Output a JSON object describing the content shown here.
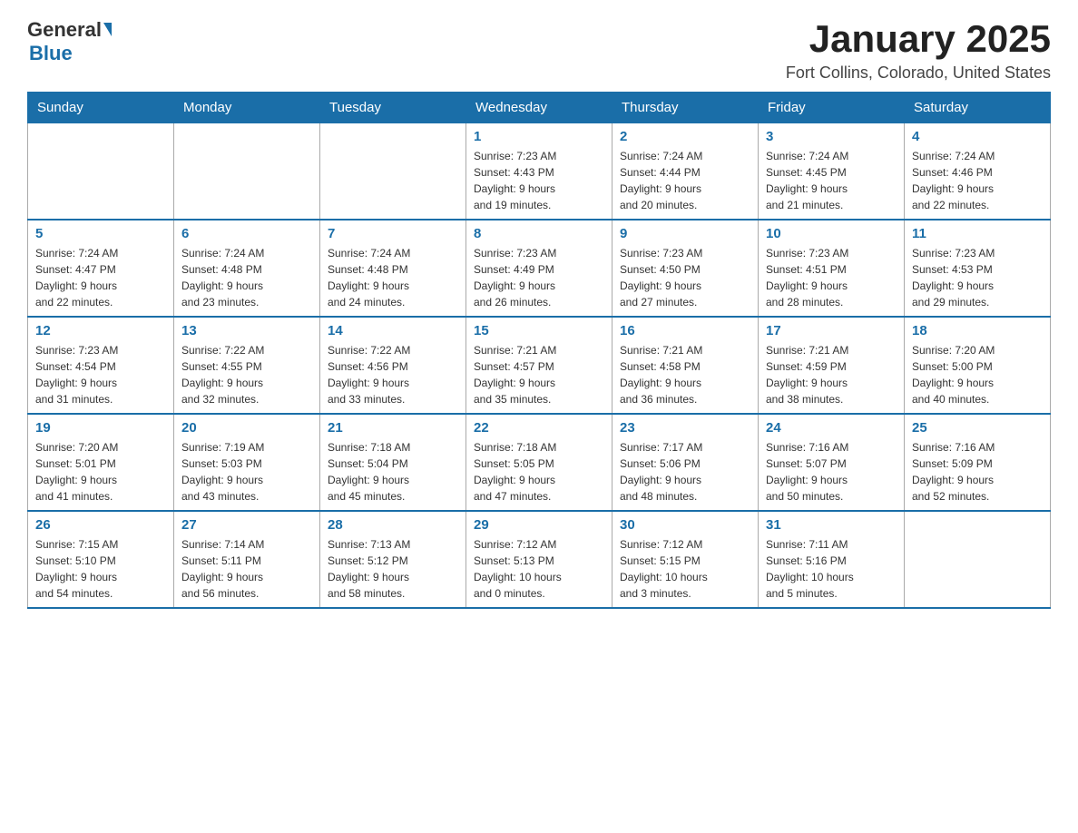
{
  "header": {
    "logo_general": "General",
    "logo_blue": "Blue",
    "month_title": "January 2025",
    "location": "Fort Collins, Colorado, United States"
  },
  "weekdays": [
    "Sunday",
    "Monday",
    "Tuesday",
    "Wednesday",
    "Thursday",
    "Friday",
    "Saturday"
  ],
  "weeks": [
    [
      {
        "day": "",
        "info": ""
      },
      {
        "day": "",
        "info": ""
      },
      {
        "day": "",
        "info": ""
      },
      {
        "day": "1",
        "info": "Sunrise: 7:23 AM\nSunset: 4:43 PM\nDaylight: 9 hours\nand 19 minutes."
      },
      {
        "day": "2",
        "info": "Sunrise: 7:24 AM\nSunset: 4:44 PM\nDaylight: 9 hours\nand 20 minutes."
      },
      {
        "day": "3",
        "info": "Sunrise: 7:24 AM\nSunset: 4:45 PM\nDaylight: 9 hours\nand 21 minutes."
      },
      {
        "day": "4",
        "info": "Sunrise: 7:24 AM\nSunset: 4:46 PM\nDaylight: 9 hours\nand 22 minutes."
      }
    ],
    [
      {
        "day": "5",
        "info": "Sunrise: 7:24 AM\nSunset: 4:47 PM\nDaylight: 9 hours\nand 22 minutes."
      },
      {
        "day": "6",
        "info": "Sunrise: 7:24 AM\nSunset: 4:48 PM\nDaylight: 9 hours\nand 23 minutes."
      },
      {
        "day": "7",
        "info": "Sunrise: 7:24 AM\nSunset: 4:48 PM\nDaylight: 9 hours\nand 24 minutes."
      },
      {
        "day": "8",
        "info": "Sunrise: 7:23 AM\nSunset: 4:49 PM\nDaylight: 9 hours\nand 26 minutes."
      },
      {
        "day": "9",
        "info": "Sunrise: 7:23 AM\nSunset: 4:50 PM\nDaylight: 9 hours\nand 27 minutes."
      },
      {
        "day": "10",
        "info": "Sunrise: 7:23 AM\nSunset: 4:51 PM\nDaylight: 9 hours\nand 28 minutes."
      },
      {
        "day": "11",
        "info": "Sunrise: 7:23 AM\nSunset: 4:53 PM\nDaylight: 9 hours\nand 29 minutes."
      }
    ],
    [
      {
        "day": "12",
        "info": "Sunrise: 7:23 AM\nSunset: 4:54 PM\nDaylight: 9 hours\nand 31 minutes."
      },
      {
        "day": "13",
        "info": "Sunrise: 7:22 AM\nSunset: 4:55 PM\nDaylight: 9 hours\nand 32 minutes."
      },
      {
        "day": "14",
        "info": "Sunrise: 7:22 AM\nSunset: 4:56 PM\nDaylight: 9 hours\nand 33 minutes."
      },
      {
        "day": "15",
        "info": "Sunrise: 7:21 AM\nSunset: 4:57 PM\nDaylight: 9 hours\nand 35 minutes."
      },
      {
        "day": "16",
        "info": "Sunrise: 7:21 AM\nSunset: 4:58 PM\nDaylight: 9 hours\nand 36 minutes."
      },
      {
        "day": "17",
        "info": "Sunrise: 7:21 AM\nSunset: 4:59 PM\nDaylight: 9 hours\nand 38 minutes."
      },
      {
        "day": "18",
        "info": "Sunrise: 7:20 AM\nSunset: 5:00 PM\nDaylight: 9 hours\nand 40 minutes."
      }
    ],
    [
      {
        "day": "19",
        "info": "Sunrise: 7:20 AM\nSunset: 5:01 PM\nDaylight: 9 hours\nand 41 minutes."
      },
      {
        "day": "20",
        "info": "Sunrise: 7:19 AM\nSunset: 5:03 PM\nDaylight: 9 hours\nand 43 minutes."
      },
      {
        "day": "21",
        "info": "Sunrise: 7:18 AM\nSunset: 5:04 PM\nDaylight: 9 hours\nand 45 minutes."
      },
      {
        "day": "22",
        "info": "Sunrise: 7:18 AM\nSunset: 5:05 PM\nDaylight: 9 hours\nand 47 minutes."
      },
      {
        "day": "23",
        "info": "Sunrise: 7:17 AM\nSunset: 5:06 PM\nDaylight: 9 hours\nand 48 minutes."
      },
      {
        "day": "24",
        "info": "Sunrise: 7:16 AM\nSunset: 5:07 PM\nDaylight: 9 hours\nand 50 minutes."
      },
      {
        "day": "25",
        "info": "Sunrise: 7:16 AM\nSunset: 5:09 PM\nDaylight: 9 hours\nand 52 minutes."
      }
    ],
    [
      {
        "day": "26",
        "info": "Sunrise: 7:15 AM\nSunset: 5:10 PM\nDaylight: 9 hours\nand 54 minutes."
      },
      {
        "day": "27",
        "info": "Sunrise: 7:14 AM\nSunset: 5:11 PM\nDaylight: 9 hours\nand 56 minutes."
      },
      {
        "day": "28",
        "info": "Sunrise: 7:13 AM\nSunset: 5:12 PM\nDaylight: 9 hours\nand 58 minutes."
      },
      {
        "day": "29",
        "info": "Sunrise: 7:12 AM\nSunset: 5:13 PM\nDaylight: 10 hours\nand 0 minutes."
      },
      {
        "day": "30",
        "info": "Sunrise: 7:12 AM\nSunset: 5:15 PM\nDaylight: 10 hours\nand 3 minutes."
      },
      {
        "day": "31",
        "info": "Sunrise: 7:11 AM\nSunset: 5:16 PM\nDaylight: 10 hours\nand 5 minutes."
      },
      {
        "day": "",
        "info": ""
      }
    ]
  ]
}
